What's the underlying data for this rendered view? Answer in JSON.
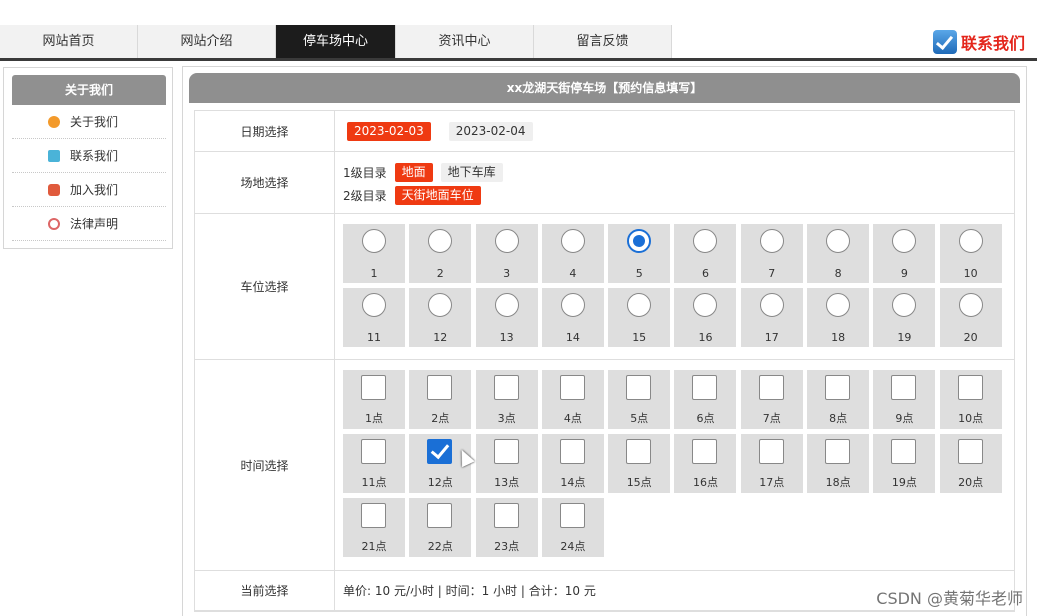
{
  "nav": {
    "tabs": [
      {
        "label": "网站首页",
        "active": false
      },
      {
        "label": "网站介绍",
        "active": false
      },
      {
        "label": "停车场中心",
        "active": true
      },
      {
        "label": "资讯中心",
        "active": false
      },
      {
        "label": "留言反馈",
        "active": false
      }
    ],
    "contact_label": "联系我们"
  },
  "sidebar": {
    "title": "关于我们",
    "items": [
      {
        "label": "关于我们",
        "icon": "info-circle-icon"
      },
      {
        "label": "联系我们",
        "icon": "contact-card-icon"
      },
      {
        "label": "加入我们",
        "icon": "lock-icon"
      },
      {
        "label": "法律声明",
        "icon": "power-icon"
      }
    ]
  },
  "panel": {
    "title": "xx龙湖天街停车场【预约信息填写】"
  },
  "form": {
    "date": {
      "label": "日期选择",
      "options": [
        {
          "text": "2023-02-03",
          "selected": true
        },
        {
          "text": "2023-02-04",
          "selected": false
        }
      ]
    },
    "venue": {
      "label": "场地选择",
      "level1_label": "1级目录",
      "level1_options": [
        {
          "text": "地面",
          "selected": true
        },
        {
          "text": "地下车库",
          "selected": false
        }
      ],
      "level2_label": "2级目录",
      "level2_options": [
        {
          "text": "天街地面车位",
          "selected": true
        }
      ]
    },
    "spot": {
      "label": "车位选择",
      "options": [
        "1",
        "2",
        "3",
        "4",
        "5",
        "6",
        "7",
        "8",
        "9",
        "10",
        "11",
        "12",
        "13",
        "14",
        "15",
        "16",
        "17",
        "18",
        "19",
        "20"
      ],
      "selected": "5"
    },
    "time": {
      "label": "时间选择",
      "options": [
        "1点",
        "2点",
        "3点",
        "4点",
        "5点",
        "6点",
        "7点",
        "8点",
        "9点",
        "10点",
        "11点",
        "12点",
        "13点",
        "14点",
        "15点",
        "16点",
        "17点",
        "18点",
        "19点",
        "20点",
        "21点",
        "22点",
        "23点",
        "24点"
      ],
      "selected": [
        "12点"
      ]
    },
    "summary": {
      "label": "当前选择",
      "text": "单价: 10 元/小时 | 时间：1 小时 | 合计：10 元"
    }
  },
  "watermark": "CSDN @黄菊华老师",
  "colors": {
    "accent_red": "#ef3a12",
    "select_blue": "#1a6fd6",
    "nav_active": "#1c1c1c"
  }
}
